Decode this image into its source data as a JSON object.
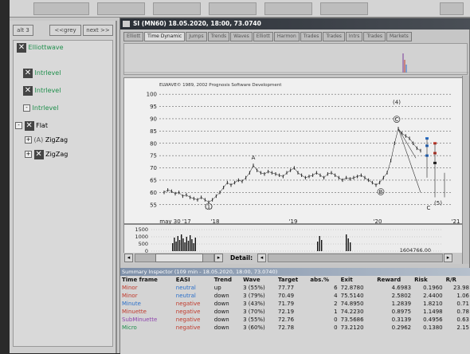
{
  "nav": {
    "back_label": "<<grey",
    "next_label": "next >>",
    "left_label": "alt 3"
  },
  "tree": [
    {
      "label": "Elliottwave",
      "color": "#1f8f4c"
    },
    {
      "label": "Intrlevel",
      "color": "#1f8f4c"
    },
    {
      "label": "Intrlevel",
      "color": "#1f8f4c"
    },
    {
      "label": "Intrlevel",
      "color": "#1f8f4c"
    },
    {
      "label": "Flat",
      "color": "#111111"
    },
    {
      "label": "ZigZag",
      "color": "#111111"
    },
    {
      "label": "ZigZag",
      "color": "#111111"
    }
  ],
  "window": {
    "title": "SI (MN60) 18.05.2020, 18:00, 73.0740"
  },
  "tabs": [
    "Elliott",
    "Time Dynamic",
    "Jumps",
    "Trends",
    "Waves",
    "Elliott",
    "Harmon",
    "Trades",
    "Trades",
    "Intrs",
    "Trades",
    "Markets"
  ],
  "chart": {
    "copyright": "ELWAVE© 1989, 2002 Prognosis Software Development",
    "detail_label": "Detail:",
    "volume_value": "1604766.00",
    "wave_labels": [
      "A",
      "(4)",
      "C",
      "B",
      "(1)",
      "(5)",
      "C"
    ]
  },
  "chart_data": {
    "type": "line",
    "title": "",
    "x_tick_labels": [
      "may 30 '17",
      "'18",
      "'19",
      "'20",
      "'21"
    ],
    "y_ticks": [
      55,
      60,
      65,
      70,
      75,
      80,
      85,
      90,
      95,
      100
    ],
    "y_tick_labels": [
      "55",
      "60",
      "65",
      "70",
      "75",
      "80",
      "85",
      "90",
      "95",
      "100"
    ],
    "ylim": [
      52,
      102
    ],
    "series": [
      {
        "values": [
          60,
          61,
          60.5,
          59.5,
          60,
          58.5,
          59,
          58,
          57.5,
          57,
          58,
          57,
          56,
          57,
          58.5,
          60,
          62,
          64,
          63,
          64,
          65,
          64.5,
          66,
          68,
          71,
          69,
          68,
          67.5,
          68.5,
          68,
          67.5,
          67,
          66.5,
          68,
          69,
          70,
          68,
          67,
          66,
          66.5,
          67,
          68,
          67,
          66,
          67.5,
          68,
          67,
          66,
          65,
          66,
          65.5,
          66,
          66.5,
          67,
          66,
          65,
          64,
          63,
          64,
          66,
          68,
          73,
          80,
          86,
          84,
          83,
          82,
          80,
          78,
          77
        ]
      }
    ],
    "volume": {
      "y_tick_labels": [
        "1500",
        "1000",
        "500",
        "0"
      ]
    }
  },
  "inspector": {
    "title": "Summary Inspector (109 min - 18.05.2020, 18:00, 73.0740)",
    "columns": [
      "Time frame",
      "EASI",
      "Trend",
      "Wave",
      "Target",
      "abs.%",
      "Exit",
      "Reward",
      "Risk",
      "R/R"
    ],
    "rows": [
      {
        "tf": "Minor",
        "tf_color": "#c0392b",
        "easi": "neutral",
        "easi_color": "#2a6fc9",
        "trend": "up",
        "wave": "3 (55%)",
        "target": "77.77",
        "abs": "6",
        "exit": "72.8780",
        "reward": "4.6983",
        "risk": "0.1960",
        "rr": "23.98"
      },
      {
        "tf": "Minor",
        "tf_color": "#c0392b",
        "easi": "neutral",
        "easi_color": "#2a6fc9",
        "trend": "down",
        "wave": "3 (79%)",
        "target": "70.49",
        "abs": "4",
        "exit": "75.5140",
        "reward": "2.5802",
        "risk": "2.4400",
        "rr": "1.06"
      },
      {
        "tf": "Minute",
        "tf_color": "#2a6fc9",
        "easi": "negative",
        "easi_color": "#c0392b",
        "trend": "down",
        "wave": "3 (43%)",
        "target": "71.79",
        "abs": "2",
        "exit": "74.8950",
        "reward": "1.2839",
        "risk": "1.8210",
        "rr": "0.71"
      },
      {
        "tf": "Minuette",
        "tf_color": "#c0392b",
        "easi": "negative",
        "easi_color": "#c0392b",
        "trend": "down",
        "wave": "3 (70%)",
        "target": "72.19",
        "abs": "1",
        "exit": "74.2230",
        "reward": "0.8975",
        "risk": "1.1498",
        "rr": "0.78"
      },
      {
        "tf": "SubMinuette",
        "tf_color": "#8e44ad",
        "easi": "negative",
        "easi_color": "#c0392b",
        "trend": "down",
        "wave": "3 (55%)",
        "target": "72.76",
        "abs": "0",
        "exit": "73.5686",
        "reward": "0.3139",
        "risk": "0.4956",
        "rr": "0.63"
      },
      {
        "tf": "Micro",
        "tf_color": "#1f8f4c",
        "easi": "negative",
        "easi_color": "#c0392b",
        "trend": "down",
        "wave": "3 (60%)",
        "target": "72.78",
        "abs": "0",
        "exit": "73.2120",
        "reward": "0.2962",
        "risk": "0.1380",
        "rr": "2.15"
      }
    ]
  }
}
